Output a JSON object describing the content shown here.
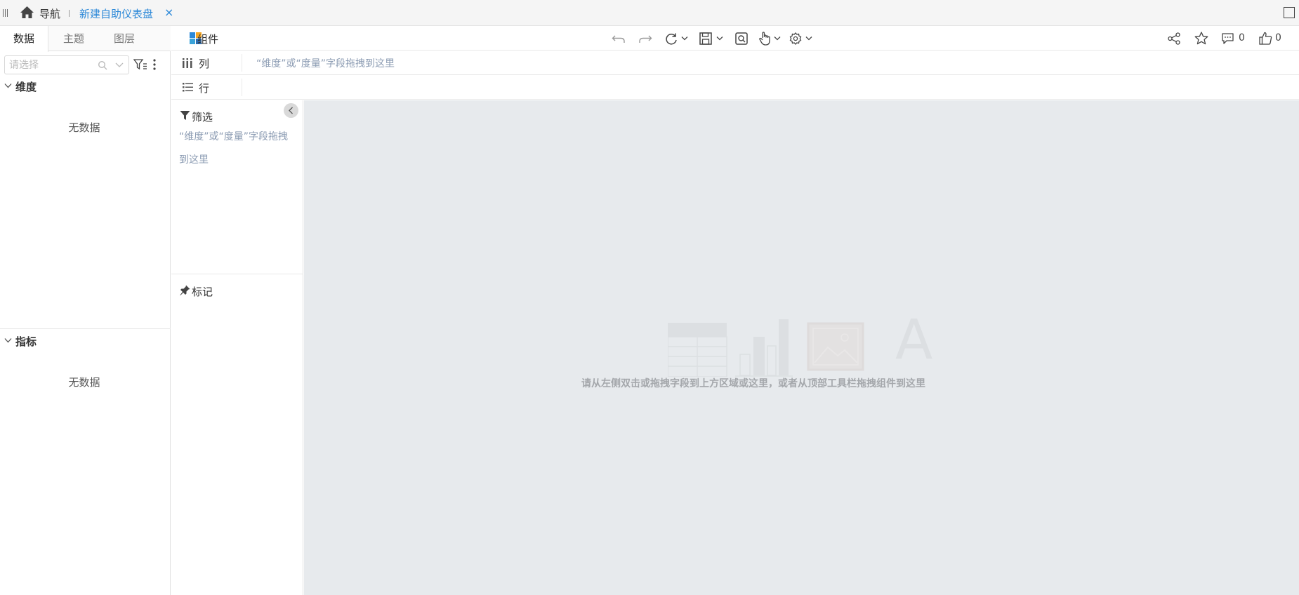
{
  "topbar": {
    "nav_label": "导航",
    "active_tab": "新建自助仪表盘",
    "close_glyph": "×"
  },
  "left_panel": {
    "tabs": [
      {
        "label": "数据",
        "active": true
      },
      {
        "label": "主题",
        "active": false
      },
      {
        "label": "图层",
        "active": false
      }
    ],
    "search_placeholder": "请选择",
    "dimensions": {
      "title": "维度",
      "empty_text": "无数据"
    },
    "measures": {
      "title": "指标",
      "empty_text": "无数据"
    }
  },
  "toolbar": {
    "component_label": "组件",
    "comment_count": "0",
    "like_count": "0"
  },
  "shelves": {
    "columns": {
      "label": "列",
      "hint": "“维度”或“度量”字段拖拽到这里"
    },
    "rows": {
      "label": "行",
      "hint": ""
    }
  },
  "filter_panel": {
    "title": "筛选",
    "hint": "“维度”或“度量”字段拖拽到这里"
  },
  "mark_panel": {
    "title": "标记"
  },
  "canvas": {
    "placeholder_glyph": "A",
    "hint": "请从左侧双击或拖拽字段到上方区域或这里，或者从顶部工具栏拖拽组件到这里"
  },
  "colors": {
    "accent": "#2b88d8",
    "hint_text": "#8c9cb3",
    "canvas_bg": "#e7eaed"
  }
}
